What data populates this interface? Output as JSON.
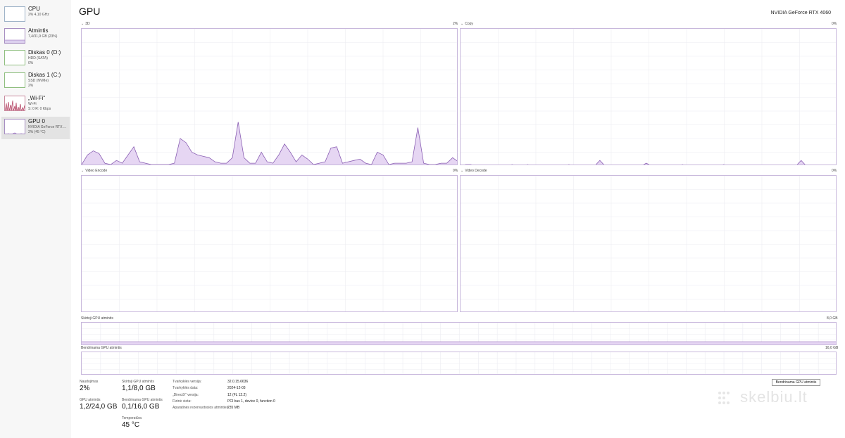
{
  "sidebar": {
    "items": [
      {
        "title": "CPU",
        "sub": [
          "2% 4,10 GHz"
        ]
      },
      {
        "title": "Atmintis",
        "sub": [
          "7,4/31,9 GB (23%)"
        ]
      },
      {
        "title": "Diskas 0 (D:)",
        "sub": [
          "HDD (SATA)",
          "0%"
        ]
      },
      {
        "title": "Diskas 1 (C:)",
        "sub": [
          "SSD (NVMe)",
          "2%"
        ]
      },
      {
        "title": "„Wi-Fi“",
        "sub": [
          "Wi-Fi",
          "S: 0 R: 0 Kbps"
        ]
      },
      {
        "title": "GPU 0",
        "sub": [
          "NVIDIA GeForce RTX ...",
          "2% (45 °C)"
        ]
      }
    ]
  },
  "header": {
    "title": "GPU",
    "model": "NVIDIA GeForce RTX 4060"
  },
  "graphs": {
    "g3d": {
      "label": "3D",
      "pct": "2%"
    },
    "copy": {
      "label": "Copy",
      "pct": "0%"
    },
    "encode": {
      "label": "Video Encode",
      "pct": "0%"
    },
    "decode": {
      "label": "Video Decode",
      "pct": "0%"
    },
    "dedicated": {
      "label": "Skirtoji GPU atmintis",
      "max": "8,0 GB"
    },
    "shared": {
      "label": "Bendrinama GPU atmintis",
      "max": "16,0 GB"
    }
  },
  "stats": {
    "utilization": {
      "label": "Naudojimas",
      "value": "2%"
    },
    "dedicated_mem": {
      "label": "Skirtoji GPU atmintis",
      "value": "1,1/8,0 GB"
    },
    "gpu_mem": {
      "label": "GPU atmintis",
      "value": "1,2/24,0 GB"
    },
    "shared_mem": {
      "label": "Bendrinama GPU atmintis",
      "value": "0,1/16,0 GB"
    },
    "temperature": {
      "label": "Temperatūra",
      "value": "45 °C"
    }
  },
  "info": [
    {
      "key": "Tvarkyklės versija:",
      "value": "32.0.15.6636"
    },
    {
      "key": "Tvarkyklės data:",
      "value": "2024-12-03"
    },
    {
      "key": "„DirectX“ versija:",
      "value": "12 (FL 12.2)"
    },
    {
      "key": "Fizinė vieta:",
      "value": "PCI bus 1, device 0, function 0"
    },
    {
      "key": "Aparatinės rezervuotosios atminties:",
      "value": "235 MB"
    }
  ],
  "buttons": {
    "dedicated_gpu_memory": "Bendrinama GPU atmintis"
  },
  "watermark": {
    "text": "skelbiu.lt"
  },
  "colors": {
    "gpu_fill": "#e6d6f3",
    "gpu_line": "#8a5fb3",
    "grid": "#ececf2",
    "border": "#c8b8dc",
    "wifi_line": "#b03a5b"
  },
  "chart_data": {
    "type": "area",
    "series": [
      {
        "name": "3D",
        "values": [
          1,
          8,
          11,
          9,
          2,
          1,
          4,
          2,
          8,
          14,
          3,
          2,
          1,
          1,
          1,
          1,
          2,
          20,
          17,
          10,
          8,
          7,
          6,
          3,
          2,
          2,
          6,
          32,
          6,
          2,
          2,
          10,
          3,
          2,
          8,
          16,
          10,
          3,
          8,
          5,
          1,
          2,
          3,
          13,
          14,
          2,
          3,
          4,
          5,
          2,
          1,
          10,
          8,
          1,
          2,
          2,
          2,
          3,
          28,
          2,
          1,
          1,
          2,
          2,
          6,
          3
        ]
      },
      {
        "name": "Copy",
        "values": [
          0,
          1,
          1,
          0,
          0,
          0,
          0,
          0,
          0,
          0,
          1,
          0,
          0,
          1,
          0,
          0,
          0,
          0,
          0,
          0,
          0,
          1,
          0,
          0,
          0,
          0,
          0,
          4,
          0,
          0,
          0,
          0,
          0,
          0,
          0,
          0,
          2,
          0,
          0,
          0,
          0,
          0,
          0,
          1,
          0,
          0,
          0,
          0,
          0,
          0,
          0,
          1,
          0,
          0,
          0,
          0,
          0,
          0,
          0,
          0,
          0,
          0,
          0,
          0,
          0,
          0,
          4,
          0,
          0,
          0,
          0,
          0,
          0,
          0
        ]
      },
      {
        "name": "Video Encode",
        "values": [
          0,
          0
        ]
      },
      {
        "name": "Video Decode",
        "values": [
          0,
          0
        ]
      }
    ],
    "ylim": [
      0,
      100
    ]
  }
}
